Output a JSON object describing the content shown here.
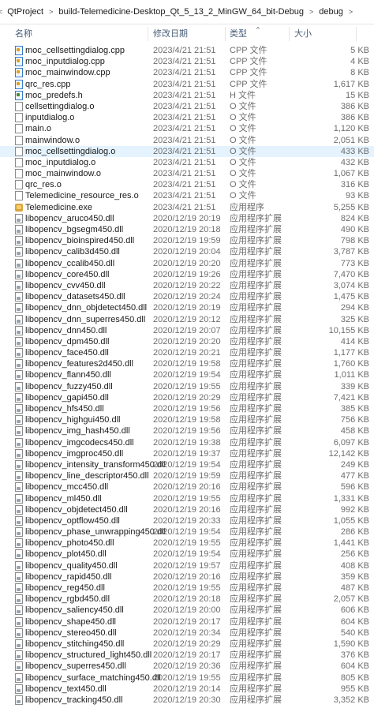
{
  "breadcrumb": {
    "lead": "<",
    "sep": ">",
    "items": [
      "QtProject",
      "build-Telemedicine-Desktop_Qt_5_13_2_MinGW_64_bit-Debug",
      "debug"
    ]
  },
  "columns": {
    "name": "名称",
    "date": "修改日期",
    "type": "类型",
    "size": "大小",
    "sort_indicator": "^"
  },
  "files": [
    {
      "name": "moc_cellsettingdialog.cpp",
      "date": "2023/4/21 21:51",
      "type": "CPP 文件",
      "size": "5 KB",
      "icon": "cpp"
    },
    {
      "name": "moc_inputdialog.cpp",
      "date": "2023/4/21 21:51",
      "type": "CPP 文件",
      "size": "4 KB",
      "icon": "cpp"
    },
    {
      "name": "moc_mainwindow.cpp",
      "date": "2023/4/21 21:51",
      "type": "CPP 文件",
      "size": "8 KB",
      "icon": "cpp"
    },
    {
      "name": "qrc_res.cpp",
      "date": "2023/4/21 21:51",
      "type": "CPP 文件",
      "size": "1,617 KB",
      "icon": "cpp"
    },
    {
      "name": "moc_predefs.h",
      "date": "2023/4/21 21:51",
      "type": "H 文件",
      "size": "15 KB",
      "icon": "h"
    },
    {
      "name": "cellsettingdialog.o",
      "date": "2023/4/21 21:51",
      "type": "O 文件",
      "size": "386 KB",
      "icon": "file"
    },
    {
      "name": "inputdialog.o",
      "date": "2023/4/21 21:51",
      "type": "O 文件",
      "size": "386 KB",
      "icon": "file"
    },
    {
      "name": "main.o",
      "date": "2023/4/21 21:51",
      "type": "O 文件",
      "size": "1,120 KB",
      "icon": "file"
    },
    {
      "name": "mainwindow.o",
      "date": "2023/4/21 21:51",
      "type": "O 文件",
      "size": "2,051 KB",
      "icon": "file"
    },
    {
      "name": "moc_cellsettingdialog.o",
      "date": "2023/4/21 21:51",
      "type": "O 文件",
      "size": "433 KB",
      "icon": "file",
      "selected": true
    },
    {
      "name": "moc_inputdialog.o",
      "date": "2023/4/21 21:51",
      "type": "O 文件",
      "size": "432 KB",
      "icon": "file"
    },
    {
      "name": "moc_mainwindow.o",
      "date": "2023/4/21 21:51",
      "type": "O 文件",
      "size": "1,067 KB",
      "icon": "file"
    },
    {
      "name": "qrc_res.o",
      "date": "2023/4/21 21:51",
      "type": "O 文件",
      "size": "316 KB",
      "icon": "file"
    },
    {
      "name": "Telemedicine_resource_res.o",
      "date": "2023/4/21 21:51",
      "type": "O 文件",
      "size": "93 KB",
      "icon": "file"
    },
    {
      "name": "Telemedicine.exe",
      "date": "2023/4/21 21:51",
      "type": "应用程序",
      "size": "5,255 KB",
      "icon": "exe"
    },
    {
      "name": "libopencv_aruco450.dll",
      "date": "2020/12/19 20:19",
      "type": "应用程序扩展",
      "size": "824 KB",
      "icon": "dll"
    },
    {
      "name": "libopencv_bgsegm450.dll",
      "date": "2020/12/19 20:18",
      "type": "应用程序扩展",
      "size": "490 KB",
      "icon": "dll"
    },
    {
      "name": "libopencv_bioinspired450.dll",
      "date": "2020/12/19 19:59",
      "type": "应用程序扩展",
      "size": "798 KB",
      "icon": "dll"
    },
    {
      "name": "libopencv_calib3d450.dll",
      "date": "2020/12/19 20:04",
      "type": "应用程序扩展",
      "size": "3,787 KB",
      "icon": "dll"
    },
    {
      "name": "libopencv_ccalib450.dll",
      "date": "2020/12/19 20:20",
      "type": "应用程序扩展",
      "size": "773 KB",
      "icon": "dll"
    },
    {
      "name": "libopencv_core450.dll",
      "date": "2020/12/19 19:26",
      "type": "应用程序扩展",
      "size": "7,470 KB",
      "icon": "dll"
    },
    {
      "name": "libopencv_cvv450.dll",
      "date": "2020/12/19 20:22",
      "type": "应用程序扩展",
      "size": "3,074 KB",
      "icon": "dll"
    },
    {
      "name": "libopencv_datasets450.dll",
      "date": "2020/12/19 20:24",
      "type": "应用程序扩展",
      "size": "1,475 KB",
      "icon": "dll"
    },
    {
      "name": "libopencv_dnn_objdetect450.dll",
      "date": "2020/12/19 20:19",
      "type": "应用程序扩展",
      "size": "294 KB",
      "icon": "dll"
    },
    {
      "name": "libopencv_dnn_superres450.dll",
      "date": "2020/12/19 20:12",
      "type": "应用程序扩展",
      "size": "325 KB",
      "icon": "dll"
    },
    {
      "name": "libopencv_dnn450.dll",
      "date": "2020/12/19 20:07",
      "type": "应用程序扩展",
      "size": "10,155 KB",
      "icon": "dll"
    },
    {
      "name": "libopencv_dpm450.dll",
      "date": "2020/12/19 20:20",
      "type": "应用程序扩展",
      "size": "414 KB",
      "icon": "dll"
    },
    {
      "name": "libopencv_face450.dll",
      "date": "2020/12/19 20:21",
      "type": "应用程序扩展",
      "size": "1,177 KB",
      "icon": "dll"
    },
    {
      "name": "libopencv_features2d450.dll",
      "date": "2020/12/19 19:58",
      "type": "应用程序扩展",
      "size": "1,760 KB",
      "icon": "dll"
    },
    {
      "name": "libopencv_flann450.dll",
      "date": "2020/12/19 19:54",
      "type": "应用程序扩展",
      "size": "1,011 KB",
      "icon": "dll"
    },
    {
      "name": "libopencv_fuzzy450.dll",
      "date": "2020/12/19 19:55",
      "type": "应用程序扩展",
      "size": "339 KB",
      "icon": "dll"
    },
    {
      "name": "libopencv_gapi450.dll",
      "date": "2020/12/19 20:29",
      "type": "应用程序扩展",
      "size": "7,421 KB",
      "icon": "dll"
    },
    {
      "name": "libopencv_hfs450.dll",
      "date": "2020/12/19 19:56",
      "type": "应用程序扩展",
      "size": "385 KB",
      "icon": "dll"
    },
    {
      "name": "libopencv_highgui450.dll",
      "date": "2020/12/19 19:58",
      "type": "应用程序扩展",
      "size": "756 KB",
      "icon": "dll"
    },
    {
      "name": "libopencv_img_hash450.dll",
      "date": "2020/12/19 19:56",
      "type": "应用程序扩展",
      "size": "458 KB",
      "icon": "dll"
    },
    {
      "name": "libopencv_imgcodecs450.dll",
      "date": "2020/12/19 19:38",
      "type": "应用程序扩展",
      "size": "6,097 KB",
      "icon": "dll"
    },
    {
      "name": "libopencv_imgproc450.dll",
      "date": "2020/12/19 19:37",
      "type": "应用程序扩展",
      "size": "12,142 KB",
      "icon": "dll"
    },
    {
      "name": "libopencv_intensity_transform450.dll",
      "date": "2020/12/19 19:54",
      "type": "应用程序扩展",
      "size": "249 KB",
      "icon": "dll"
    },
    {
      "name": "libopencv_line_descriptor450.dll",
      "date": "2020/12/19 19:59",
      "type": "应用程序扩展",
      "size": "477 KB",
      "icon": "dll"
    },
    {
      "name": "libopencv_mcc450.dll",
      "date": "2020/12/19 20:16",
      "type": "应用程序扩展",
      "size": "596 KB",
      "icon": "dll"
    },
    {
      "name": "libopencv_ml450.dll",
      "date": "2020/12/19 19:55",
      "type": "应用程序扩展",
      "size": "1,331 KB",
      "icon": "dll"
    },
    {
      "name": "libopencv_objdetect450.dll",
      "date": "2020/12/19 20:16",
      "type": "应用程序扩展",
      "size": "992 KB",
      "icon": "dll"
    },
    {
      "name": "libopencv_optflow450.dll",
      "date": "2020/12/19 20:33",
      "type": "应用程序扩展",
      "size": "1,055 KB",
      "icon": "dll"
    },
    {
      "name": "libopencv_phase_unwrapping450.dll",
      "date": "2020/12/19 19:54",
      "type": "应用程序扩展",
      "size": "286 KB",
      "icon": "dll"
    },
    {
      "name": "libopencv_photo450.dll",
      "date": "2020/12/19 19:55",
      "type": "应用程序扩展",
      "size": "1,441 KB",
      "icon": "dll"
    },
    {
      "name": "libopencv_plot450.dll",
      "date": "2020/12/19 19:54",
      "type": "应用程序扩展",
      "size": "256 KB",
      "icon": "dll"
    },
    {
      "name": "libopencv_quality450.dll",
      "date": "2020/12/19 19:57",
      "type": "应用程序扩展",
      "size": "408 KB",
      "icon": "dll"
    },
    {
      "name": "libopencv_rapid450.dll",
      "date": "2020/12/19 20:16",
      "type": "应用程序扩展",
      "size": "359 KB",
      "icon": "dll"
    },
    {
      "name": "libopencv_reg450.dll",
      "date": "2020/12/19 19:55",
      "type": "应用程序扩展",
      "size": "487 KB",
      "icon": "dll"
    },
    {
      "name": "libopencv_rgbd450.dll",
      "date": "2020/12/19 20:18",
      "type": "应用程序扩展",
      "size": "2,057 KB",
      "icon": "dll"
    },
    {
      "name": "libopencv_saliency450.dll",
      "date": "2020/12/19 20:00",
      "type": "应用程序扩展",
      "size": "606 KB",
      "icon": "dll"
    },
    {
      "name": "libopencv_shape450.dll",
      "date": "2020/12/19 20:17",
      "type": "应用程序扩展",
      "size": "604 KB",
      "icon": "dll"
    },
    {
      "name": "libopencv_stereo450.dll",
      "date": "2020/12/19 20:34",
      "type": "应用程序扩展",
      "size": "540 KB",
      "icon": "dll"
    },
    {
      "name": "libopencv_stitching450.dll",
      "date": "2020/12/19 20:29",
      "type": "应用程序扩展",
      "size": "1,590 KB",
      "icon": "dll"
    },
    {
      "name": "libopencv_structured_light450.dll",
      "date": "2020/12/19 20:17",
      "type": "应用程序扩展",
      "size": "376 KB",
      "icon": "dll"
    },
    {
      "name": "libopencv_superres450.dll",
      "date": "2020/12/19 20:36",
      "type": "应用程序扩展",
      "size": "604 KB",
      "icon": "dll"
    },
    {
      "name": "libopencv_surface_matching450.dll",
      "date": "2020/12/19 19:55",
      "type": "应用程序扩展",
      "size": "805 KB",
      "icon": "dll"
    },
    {
      "name": "libopencv_text450.dll",
      "date": "2020/12/19 20:14",
      "type": "应用程序扩展",
      "size": "955 KB",
      "icon": "dll"
    },
    {
      "name": "libopencv_tracking450.dll",
      "date": "2020/12/19 20:30",
      "type": "应用程序扩展",
      "size": "3,352 KB",
      "icon": "dll"
    }
  ]
}
